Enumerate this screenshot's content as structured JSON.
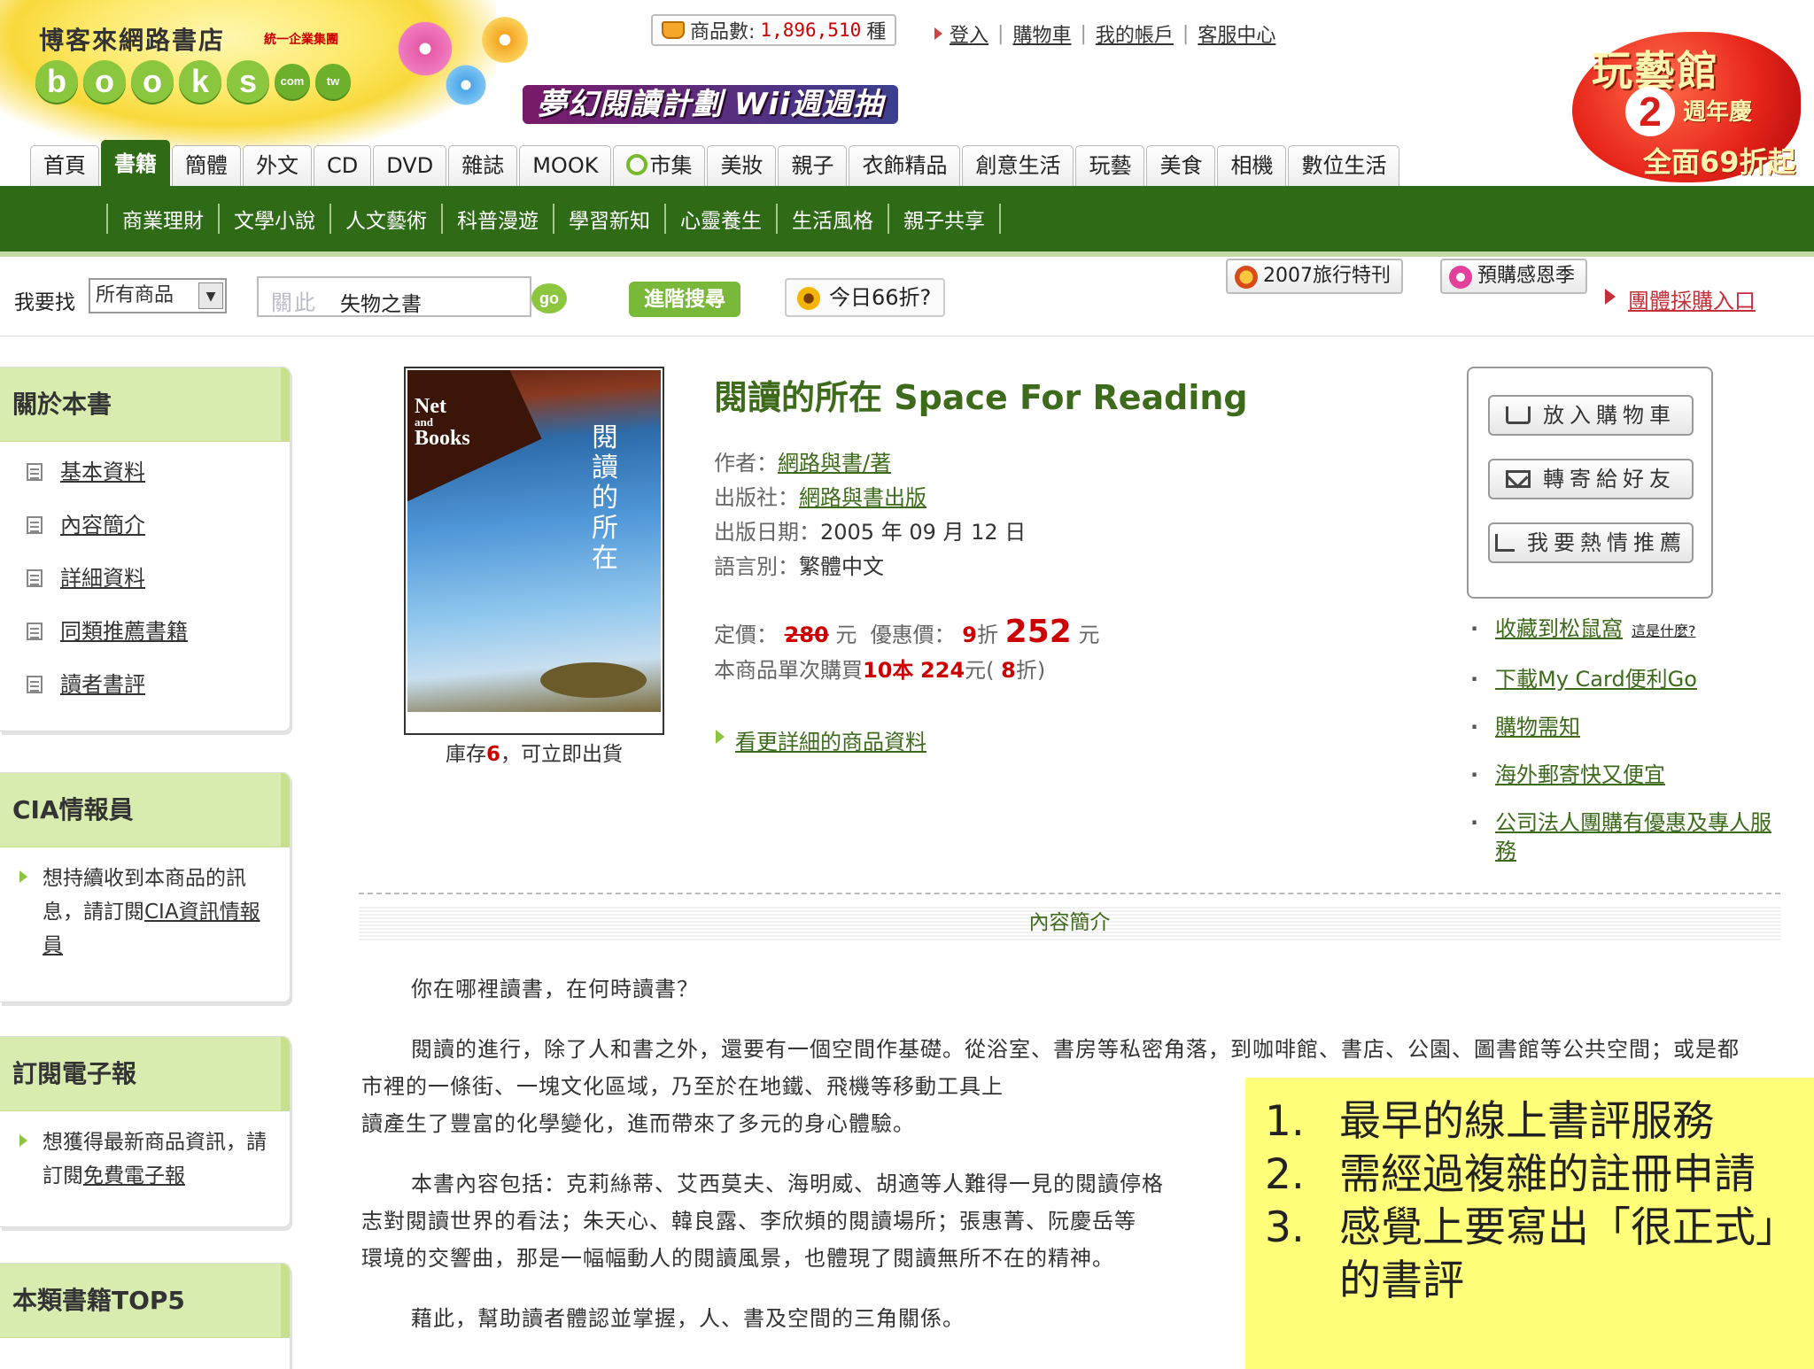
{
  "header": {
    "store_name": "博客來網路書店",
    "group": "統一企業集團",
    "logo_letters": [
      "b",
      "o",
      "o",
      "k",
      "s"
    ],
    "logo_com": "com",
    "logo_tw": "tw",
    "count_label": "商品數:",
    "count_value": "1,896,510",
    "count_unit": "種",
    "banner": "夢幻閱讀計劃 Wii週週抽",
    "user_links": [
      "登入",
      "購物車",
      "我的帳戶",
      "客服中心"
    ],
    "anniversary": {
      "title": "玩藝館",
      "num": "2",
      "sub": "週年慶",
      "deal": "全面69折起"
    }
  },
  "tabs": [
    "首頁",
    "書籍",
    "簡體",
    "外文",
    "CD",
    "DVD",
    "雜誌",
    "MOOK",
    "市集",
    "美妝",
    "親子",
    "衣飾精品",
    "創意生活",
    "玩藝",
    "美食",
    "相機",
    "數位生活"
  ],
  "active_tab": "書籍",
  "subnav": [
    "商業理財",
    "文學小說",
    "人文藝術",
    "科普漫遊",
    "學習新知",
    "心靈養生",
    "生活風格",
    "親子共享"
  ],
  "search": {
    "label": "我要找",
    "category": "所有商品",
    "hint": "關此",
    "query": "失物之書",
    "go": "go",
    "advanced": "進階搜尋",
    "today": "今日66折?",
    "promo1": "2007旅行特刊",
    "promo2": "預購感恩季",
    "group_buy": "團體採購入口"
  },
  "sidebar": {
    "about": {
      "title": "關於本書",
      "items": [
        "基本資料",
        "內容簡介",
        "詳細資料",
        "同類推薦書籍",
        "讀者書評"
      ]
    },
    "cia": {
      "title": "CIA情報員",
      "text": "想持續收到本商品的訊息，請訂閱",
      "link": "CIA資訊情報員"
    },
    "newsletter": {
      "title": "訂閱電子報",
      "text": "想獲得最新商品資訊，請訂閱",
      "link": "免費電子報"
    },
    "top5": {
      "title": "本類書籍TOP5"
    }
  },
  "book": {
    "cover_brand": "Net and Books",
    "cover_title": "閱讀的所在",
    "title": "閱讀的所在 Space For Reading",
    "author_label": "作者：",
    "author": "網路與書/著",
    "publisher_label": "出版社：",
    "publisher": "網路與書出版",
    "date_label": "出版日期：",
    "date": "2005 年 09 月 12 日",
    "lang_label": "語言別：",
    "lang": "繁體中文",
    "list_price_label": "定價：",
    "list_price": "280",
    "currency": "元",
    "sale_label": "優惠價：",
    "sale_discount": "9",
    "zhe": "折",
    "sale_price": "252",
    "bulk_prefix": "本商品單次購買",
    "bulk_qty": "10本",
    "bulk_price": "224",
    "bulk_suffix": "元(",
    "bulk_discount": "8",
    "bulk_end": "折)",
    "stock_label": "庫存",
    "stock_qty": "6",
    "stock_suffix": "，可立即出貨",
    "more_link": "看更詳細的商品資料"
  },
  "actions": [
    "放入購物車",
    "轉寄給好友",
    "我要熱情推薦"
  ],
  "side_links": [
    {
      "text": "收藏到松鼠窩",
      "extra": "這是什麼?"
    },
    {
      "text": "下載My Card便利Go"
    },
    {
      "text": "購物需知"
    },
    {
      "text": "海外郵寄快又便宜"
    },
    {
      "text": "公司法人團購有優惠及專人服務"
    }
  ],
  "section_title": "內容簡介",
  "description": [
    "你在哪裡讀書，在何時讀書？",
    "閱讀的進行，除了人和書之外，還要有一個空間作基礎。從浴室、書房等私密角落，到咖啡館、書店、公園、圖書館等公共空間；或是都市裡的一條街、一塊文化區域，乃至於在地鐵、飛機等移動工具上",
    "讀產生了豐富的化學變化，進而帶來了多元的身心體驗。",
    "本書內容包括：克莉絲蒂、艾西莫夫、海明威、胡適等人難得一見的閱讀停格",
    "志對閱讀世界的看法；朱天心、韓良露、李欣頻的閱讀場所；張惠菁、阮慶岳等",
    "環境的交響曲，那是一幅幅動人的閱讀風景，也體現了閱讀無所不在的精神。",
    "藉此，幫助讀者體認並掌握，人、書及空間的三角關係。"
  ],
  "note": [
    {
      "num": "1.",
      "text": "最早的線上書評服務"
    },
    {
      "num": "2.",
      "text": "需經過複雜的註冊申請"
    },
    {
      "num": "3.",
      "text": "感覺上要寫出「很正式」的書評"
    }
  ]
}
